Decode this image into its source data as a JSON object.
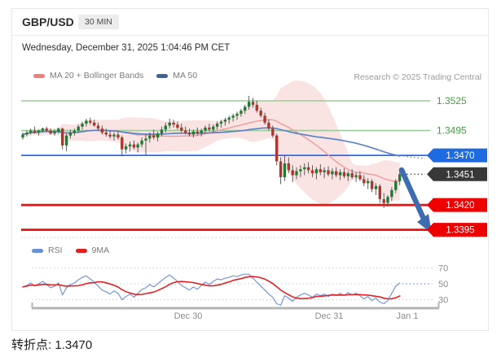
{
  "header": {
    "symbol": "GBP/USD",
    "interval": "30 MIN",
    "datetime": "Wednesday, December 31, 2025 1:04:46 PM CET"
  },
  "legend": {
    "ma20": "MA 20 + Bollinger Bands",
    "ma50": "MA 50",
    "research": "Research © 2025 Trading Central"
  },
  "rsi_legend": {
    "rsi": "RSI",
    "ma9": "9MA"
  },
  "footer": {
    "pivot_label": "转折点:",
    "pivot_value": "1.3470"
  },
  "colors": {
    "green_line": "#9ccb97",
    "green_text": "#3da33d",
    "blue_line": "#2c6ce5",
    "blue_badge": "#1e6ae1",
    "red_line": "#ee0f0f",
    "red_badge": "#ef0000",
    "dark_badge": "#383838",
    "candle_up": "#1c7c33",
    "candle_down": "#b0352c",
    "wick": "#4d4d4d",
    "bb_fill": "#f3bcbc",
    "ma20_line": "#ee9a9c",
    "ma50_line": "#5b84c6",
    "rsi_line": "#7695da",
    "rsi_ma_line": "#e12222",
    "grid": "#c9c9c9",
    "axis": "#b5b5b5",
    "axis_text": "#8c8c8c",
    "arrow": "#3e6cb0"
  },
  "chart_data": {
    "type": "candlestick",
    "title": "GBP/USD 30 MIN",
    "x_axis": {
      "labels": [
        "Dec 30",
        "Dec 31",
        "Jan 1"
      ]
    },
    "price_pane": {
      "ylim": [
        1.338,
        1.3545
      ],
      "levels": [
        {
          "price": 1.3525,
          "label": "1.3525",
          "style": "green-line"
        },
        {
          "price": 1.3495,
          "label": "1.3495",
          "style": "green-line"
        },
        {
          "price": 1.347,
          "label": "1.3470",
          "style": "blue-badge"
        },
        {
          "price": 1.3451,
          "label": "1.3451",
          "style": "dark-badge"
        },
        {
          "price": 1.342,
          "label": "1.3420",
          "style": "red-badge"
        },
        {
          "price": 1.3395,
          "label": "1.3395",
          "style": "red-badge"
        }
      ],
      "indicators": {
        "ma20_window": 20,
        "bollinger_mult": 2,
        "ma50_window": 50
      },
      "candles": [
        [
          1.3488,
          1.3493,
          1.3486,
          1.3491
        ],
        [
          1.3491,
          1.3495,
          1.3489,
          1.3493
        ],
        [
          1.3493,
          1.3497,
          1.3491,
          1.3495
        ],
        [
          1.3495,
          1.3499,
          1.3492,
          1.3493
        ],
        [
          1.3493,
          1.3496,
          1.349,
          1.3495
        ],
        [
          1.3495,
          1.3498,
          1.3493,
          1.3497
        ],
        [
          1.3497,
          1.3499,
          1.3494,
          1.3495
        ],
        [
          1.3495,
          1.3497,
          1.3491,
          1.3492
        ],
        [
          1.3492,
          1.3496,
          1.349,
          1.3494
        ],
        [
          1.3494,
          1.3498,
          1.3492,
          1.3497
        ],
        [
          1.3497,
          1.3498,
          1.3476,
          1.348
        ],
        [
          1.348,
          1.3492,
          1.3474,
          1.349
        ],
        [
          1.349,
          1.3496,
          1.3487,
          1.3493
        ],
        [
          1.3493,
          1.3497,
          1.349,
          1.3495
        ],
        [
          1.3495,
          1.3501,
          1.3493,
          1.3499
        ],
        [
          1.3499,
          1.3504,
          1.3496,
          1.3502
        ],
        [
          1.3502,
          1.3507,
          1.3499,
          1.3505
        ],
        [
          1.3505,
          1.3508,
          1.3501,
          1.3503
        ],
        [
          1.3503,
          1.3506,
          1.3499,
          1.35
        ],
        [
          1.35,
          1.3503,
          1.3495,
          1.3497
        ],
        [
          1.3497,
          1.35,
          1.3491,
          1.3493
        ],
        [
          1.3493,
          1.3497,
          1.3489,
          1.3491
        ],
        [
          1.3491,
          1.3495,
          1.3487,
          1.3489
        ],
        [
          1.3489,
          1.3493,
          1.3485,
          1.3491
        ],
        [
          1.3491,
          1.3494,
          1.3486,
          1.3488
        ],
        [
          1.3488,
          1.349,
          1.3469,
          1.3476
        ],
        [
          1.3476,
          1.3482,
          1.3472,
          1.3479
        ],
        [
          1.3479,
          1.3484,
          1.3474,
          1.3481
        ],
        [
          1.3481,
          1.3485,
          1.3476,
          1.3478
        ],
        [
          1.3478,
          1.3483,
          1.3473,
          1.3481
        ],
        [
          1.3481,
          1.3488,
          1.3478,
          1.3485
        ],
        [
          1.3485,
          1.3491,
          1.347,
          1.3487
        ],
        [
          1.3487,
          1.3493,
          1.3483,
          1.349
        ],
        [
          1.349,
          1.3496,
          1.3486,
          1.3488
        ],
        [
          1.3488,
          1.3494,
          1.3484,
          1.3492
        ],
        [
          1.3492,
          1.3499,
          1.3489,
          1.3496
        ],
        [
          1.3496,
          1.3503,
          1.3493,
          1.35
        ],
        [
          1.35,
          1.3507,
          1.3497,
          1.3503
        ],
        [
          1.3503,
          1.3506,
          1.3498,
          1.3501
        ],
        [
          1.3501,
          1.3504,
          1.3496,
          1.3498
        ],
        [
          1.3498,
          1.3502,
          1.3493,
          1.3495
        ],
        [
          1.3495,
          1.3499,
          1.3491,
          1.3493
        ],
        [
          1.3493,
          1.3497,
          1.3489,
          1.3491
        ],
        [
          1.3491,
          1.3496,
          1.3488,
          1.3494
        ],
        [
          1.3494,
          1.3498,
          1.349,
          1.3492
        ],
        [
          1.3492,
          1.3497,
          1.3489,
          1.3495
        ],
        [
          1.3495,
          1.35,
          1.3492,
          1.3498
        ],
        [
          1.3498,
          1.3502,
          1.3494,
          1.3496
        ],
        [
          1.3496,
          1.3501,
          1.3493,
          1.3499
        ],
        [
          1.3499,
          1.3504,
          1.3496,
          1.3502
        ],
        [
          1.3502,
          1.3506,
          1.3498,
          1.3504
        ],
        [
          1.3504,
          1.3508,
          1.35,
          1.3506
        ],
        [
          1.3506,
          1.351,
          1.3502,
          1.3508
        ],
        [
          1.3508,
          1.3512,
          1.3504,
          1.351
        ],
        [
          1.351,
          1.3514,
          1.3506,
          1.3512
        ],
        [
          1.3512,
          1.3517,
          1.3509,
          1.3515
        ],
        [
          1.3515,
          1.3521,
          1.3512,
          1.3519
        ],
        [
          1.3519,
          1.353,
          1.3516,
          1.3524
        ],
        [
          1.3524,
          1.3528,
          1.3518,
          1.3521
        ],
        [
          1.3521,
          1.3525,
          1.3513,
          1.3515
        ],
        [
          1.3515,
          1.3518,
          1.3508,
          1.351
        ],
        [
          1.351,
          1.3513,
          1.3501,
          1.3503
        ],
        [
          1.3503,
          1.3506,
          1.3495,
          1.3497
        ],
        [
          1.3497,
          1.35,
          1.3488,
          1.349
        ],
        [
          1.349,
          1.3492,
          1.346,
          1.3464
        ],
        [
          1.3464,
          1.3468,
          1.3441,
          1.3448
        ],
        [
          1.3448,
          1.347,
          1.3444,
          1.3462
        ],
        [
          1.3462,
          1.3468,
          1.3452,
          1.3455
        ],
        [
          1.3455,
          1.346,
          1.3443,
          1.345
        ],
        [
          1.345,
          1.3458,
          1.3446,
          1.3454
        ],
        [
          1.3454,
          1.346,
          1.3448,
          1.3456
        ],
        [
          1.3456,
          1.3462,
          1.345,
          1.3458
        ],
        [
          1.3458,
          1.3463,
          1.3452,
          1.3455
        ],
        [
          1.3455,
          1.346,
          1.3448,
          1.3452
        ],
        [
          1.3452,
          1.3458,
          1.3446,
          1.3456
        ],
        [
          1.3456,
          1.3461,
          1.345,
          1.3453
        ],
        [
          1.3453,
          1.3458,
          1.3447,
          1.3455
        ],
        [
          1.3455,
          1.3459,
          1.3449,
          1.3451
        ],
        [
          1.3451,
          1.3457,
          1.3446,
          1.3454
        ],
        [
          1.3454,
          1.3458,
          1.3448,
          1.345
        ],
        [
          1.345,
          1.3456,
          1.3445,
          1.3453
        ],
        [
          1.3453,
          1.3457,
          1.3447,
          1.3449
        ],
        [
          1.3449,
          1.3454,
          1.3444,
          1.3452
        ],
        [
          1.3452,
          1.3456,
          1.3446,
          1.3448
        ],
        [
          1.3448,
          1.3453,
          1.3443,
          1.345
        ],
        [
          1.345,
          1.3454,
          1.3444,
          1.3446
        ],
        [
          1.3446,
          1.345,
          1.3439,
          1.3442
        ],
        [
          1.3442,
          1.3447,
          1.3436,
          1.3444
        ],
        [
          1.3444,
          1.3446,
          1.3433,
          1.3436
        ],
        [
          1.3436,
          1.3442,
          1.343,
          1.3439
        ],
        [
          1.3439,
          1.3441,
          1.3422,
          1.3426
        ],
        [
          1.3426,
          1.3432,
          1.3417,
          1.3422
        ],
        [
          1.3422,
          1.343,
          1.3418,
          1.3428
        ],
        [
          1.3428,
          1.3438,
          1.3424,
          1.3435
        ],
        [
          1.3435,
          1.3446,
          1.3432,
          1.3444
        ],
        [
          1.3444,
          1.3455,
          1.344,
          1.3451
        ]
      ]
    },
    "rsi_pane": {
      "ticks": [
        70,
        50,
        30
      ],
      "ma_window": 9,
      "rsi": [
        46,
        48,
        51,
        47,
        50,
        53,
        49,
        45,
        47,
        51,
        36,
        45,
        49,
        51,
        55,
        58,
        60,
        56,
        52,
        47,
        42,
        40,
        37,
        41,
        38,
        30,
        34,
        37,
        33,
        38,
        43,
        45,
        49,
        46,
        50,
        54,
        58,
        61,
        57,
        53,
        48,
        45,
        42,
        46,
        43,
        48,
        52,
        49,
        53,
        56,
        55,
        57,
        58,
        60,
        59,
        61,
        62,
        62,
        57,
        52,
        47,
        42,
        37,
        33,
        25,
        23,
        35,
        32,
        28,
        33,
        36,
        38,
        36,
        33,
        37,
        35,
        37,
        34,
        37,
        35,
        38,
        35,
        39,
        36,
        38,
        35,
        31,
        34,
        29,
        32,
        27,
        25,
        29,
        38,
        47,
        51
      ]
    },
    "projection": {
      "direction": "down",
      "target": 1.3395
    }
  }
}
